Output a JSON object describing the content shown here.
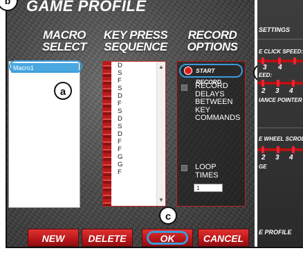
{
  "header": {
    "title": "GAME PROFILE",
    "corner_badge": "b"
  },
  "columns": {
    "macro_select": [
      "MACRO",
      "SELECT"
    ],
    "key_press_sequence": [
      "KEY PRESS",
      "SEQUENCE"
    ],
    "record_options": [
      "RECORD",
      "OPTIONS"
    ]
  },
  "macro_list": {
    "items": [
      "Macro1"
    ],
    "callout": "a"
  },
  "key_sequence": {
    "items": [
      "D",
      "S",
      "F",
      "S",
      "D",
      "F",
      "S",
      "D",
      "S",
      "D",
      "F",
      "F",
      "G",
      "G",
      "F"
    ]
  },
  "record_options": {
    "start_record": "START RECORD",
    "record_delays": [
      "RECORD",
      "DELAYS",
      "BETWEEN",
      "KEY",
      "COMMANDS"
    ],
    "loop_times": [
      "LOOP",
      "TIMES"
    ],
    "loop_value": "1"
  },
  "callouts": {
    "b": "b",
    "c": "c"
  },
  "buttons": {
    "new": "NEW",
    "delete": "DELETE",
    "ok": "OK",
    "cancel": "CANCEL"
  },
  "side_panel": {
    "settings": "SETTINGS",
    "click_speed": "E CLICK SPEED:",
    "speed": "EED:",
    "pointer": "IANCE POINTER",
    "wheel_scroll": "E WHEEL SCROL",
    "range": "GE",
    "profile": "E PROFILE",
    "nums_1": [
      "3",
      "4"
    ],
    "nums_2": [
      "2",
      "3",
      "4"
    ],
    "nums_3": [
      "2",
      "3",
      "4"
    ]
  },
  "colors": {
    "accent_blue": "#3a9bdc",
    "brand_red": "#b8161a",
    "selection_blue": "#4aa8e0"
  }
}
